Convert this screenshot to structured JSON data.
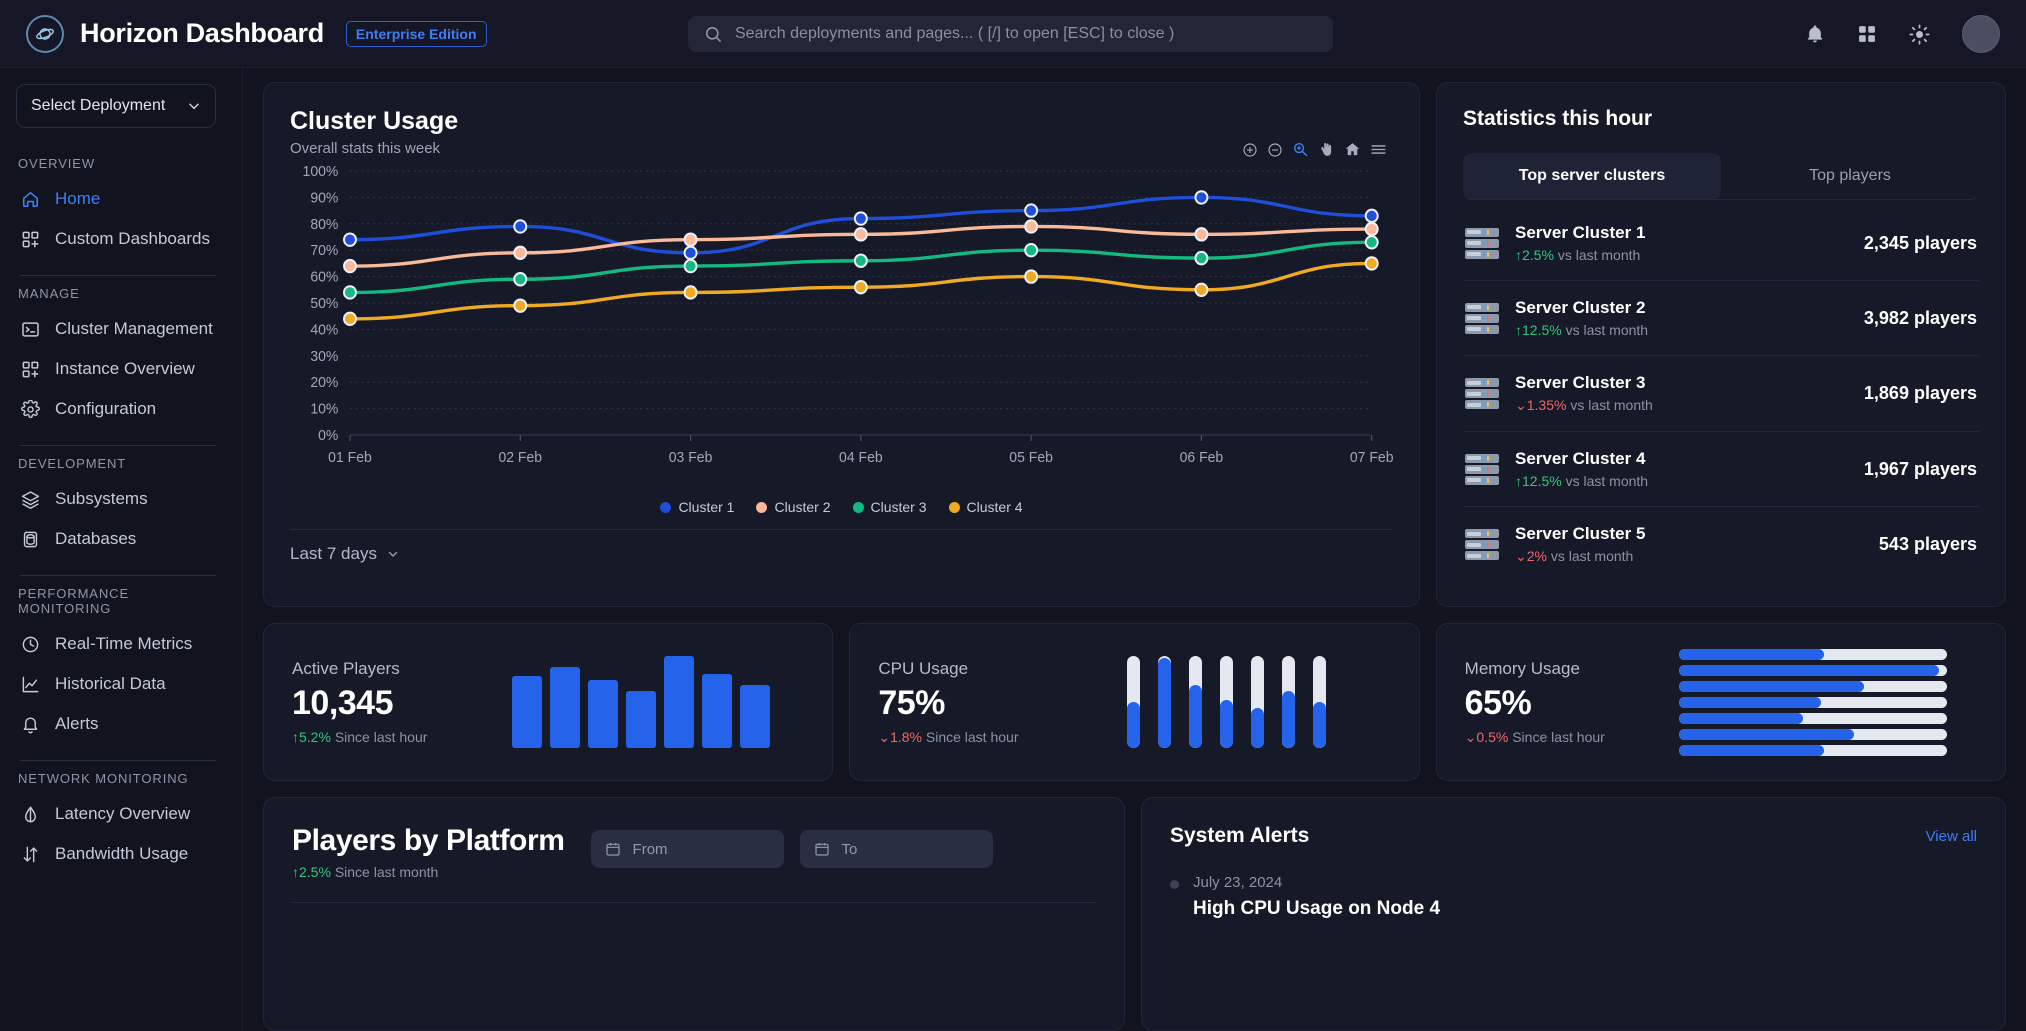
{
  "header": {
    "brand_title": "Horizon Dashboard",
    "badge": "Enterprise Edition",
    "logo_icon": "planet-icon",
    "search_placeholder": "Search deployments and pages... ( [/] to open [ESC] to close )",
    "icons": [
      "bell-icon",
      "grid-apps-icon",
      "sun-theme-icon",
      "avatar"
    ]
  },
  "sidebar": {
    "deployment_select": "Select Deployment",
    "groups": [
      {
        "label": "OVERVIEW",
        "items": [
          {
            "label": "Home",
            "icon": "home-icon",
            "active": true
          },
          {
            "label": "Custom Dashboards",
            "icon": "dashboard-add-icon",
            "active": false
          }
        ]
      },
      {
        "label": "MANAGE",
        "items": [
          {
            "label": "Cluster Management",
            "icon": "terminal-icon",
            "active": false
          },
          {
            "label": "Instance Overview",
            "icon": "dashboard-add-icon",
            "active": false
          },
          {
            "label": "Configuration",
            "icon": "gear-icon",
            "active": false
          }
        ]
      },
      {
        "label": "DEVELOPMENT",
        "items": [
          {
            "label": "Subsystems",
            "icon": "layers-icon",
            "active": false
          },
          {
            "label": "Databases",
            "icon": "database-icon",
            "active": false
          }
        ]
      },
      {
        "label": "PERFORMANCE MONITORING",
        "items": [
          {
            "label": "Real-Time Metrics",
            "icon": "clock-icon",
            "active": false
          },
          {
            "label": "Historical Data",
            "icon": "line-chart-icon",
            "active": false
          },
          {
            "label": "Alerts",
            "icon": "bell-icon",
            "active": false
          }
        ]
      },
      {
        "label": "NETWORK MONITORING",
        "items": [
          {
            "label": "Latency Overview",
            "icon": "activity-icon",
            "active": false
          },
          {
            "label": "Bandwidth Usage",
            "icon": "arrows-updown-icon",
            "active": false
          }
        ]
      }
    ]
  },
  "cluster_usage": {
    "title": "Cluster Usage",
    "subtitle": "Overall stats this week",
    "range_label": "Last 7 days",
    "toolbar": [
      "zoom-in-icon",
      "zoom-out-icon",
      "selection-zoom-icon",
      "pan-icon",
      "reset-home-icon",
      "menu-icon"
    ]
  },
  "chart_data": {
    "type": "line",
    "title": "Cluster Usage",
    "subtitle": "Overall stats this week",
    "xlabel": "",
    "ylabel": "",
    "ylim": [
      0,
      100
    ],
    "ytick_labels": [
      "100%",
      "90%",
      "80%",
      "70%",
      "60%",
      "50%",
      "40%",
      "30%",
      "20%",
      "10%",
      "0%"
    ],
    "yticks": [
      100,
      90,
      80,
      70,
      60,
      50,
      40,
      30,
      20,
      10,
      0
    ],
    "categories": [
      "01 Feb",
      "02 Feb",
      "03 Feb",
      "04 Feb",
      "05 Feb",
      "06 Feb",
      "07 Feb"
    ],
    "grid": true,
    "legend_position": "bottom",
    "markers": true,
    "curve": "smooth",
    "series": [
      {
        "name": "Cluster 1",
        "color": "#1f4fd8",
        "values": [
          74,
          79,
          69,
          82,
          85,
          90,
          83
        ]
      },
      {
        "name": "Cluster 2",
        "color": "#f9b99a",
        "values": [
          64,
          69,
          74,
          76,
          79,
          76,
          78
        ]
      },
      {
        "name": "Cluster 3",
        "color": "#13b981",
        "values": [
          54,
          59,
          64,
          66,
          70,
          67,
          73
        ]
      },
      {
        "name": "Cluster 4",
        "color": "#f0a923",
        "values": [
          44,
          49,
          54,
          56,
          60,
          55,
          65
        ]
      }
    ]
  },
  "statistics": {
    "title": "Statistics this hour",
    "tabs": [
      {
        "label": "Top server clusters",
        "active": true
      },
      {
        "label": "Top players",
        "active": false
      }
    ],
    "unit": "players",
    "vs_label": "vs last month",
    "rows": [
      {
        "name": "Server Cluster 1",
        "delta": "2.5%",
        "direction": "up",
        "count": "2,345 players"
      },
      {
        "name": "Server Cluster 2",
        "delta": "12.5%",
        "direction": "up",
        "count": "3,982 players"
      },
      {
        "name": "Server Cluster 3",
        "delta": "1.35%",
        "direction": "down",
        "count": "1,869 players"
      },
      {
        "name": "Server Cluster 4",
        "delta": "12.5%",
        "direction": "up",
        "count": "1,967 players"
      },
      {
        "name": "Server Cluster 5",
        "delta": "2%",
        "direction": "down",
        "count": "543 players"
      }
    ]
  },
  "kpis": [
    {
      "label": "Active Players",
      "value": "10,345",
      "delta": "5.2%",
      "direction": "up",
      "delta_suffix": "Since last hour",
      "viz": "bars",
      "bars": [
        78,
        88,
        74,
        62,
        100,
        80,
        68
      ]
    },
    {
      "label": "CPU Usage",
      "value": "75%",
      "delta": "1.8%",
      "direction": "down",
      "delta_suffix": "Since last hour",
      "viz": "tubes",
      "tubes": [
        50,
        98,
        68,
        52,
        44,
        62,
        50
      ]
    },
    {
      "label": "Memory Usage",
      "value": "65%",
      "delta": "0.5%",
      "direction": "down",
      "delta_suffix": "Since last hour",
      "viz": "lines",
      "lines": [
        54,
        97,
        69,
        53,
        46,
        65,
        54
      ]
    }
  ],
  "platform": {
    "title": "Players by Platform",
    "delta": "2.5%",
    "direction": "up",
    "delta_suffix": "Since last month",
    "from_placeholder": "From",
    "to_placeholder": "To"
  },
  "alerts": {
    "title": "System Alerts",
    "view_all": "View all",
    "items": [
      {
        "date": "July 23, 2024",
        "name": "High CPU Usage on Node 4"
      }
    ]
  },
  "colors": {
    "accent": "#3f7ef5",
    "bar_blue": "#2563eb",
    "up_green": "#34c77b",
    "down_red": "#f06767",
    "bg": "#11131f",
    "card": "#161927"
  }
}
